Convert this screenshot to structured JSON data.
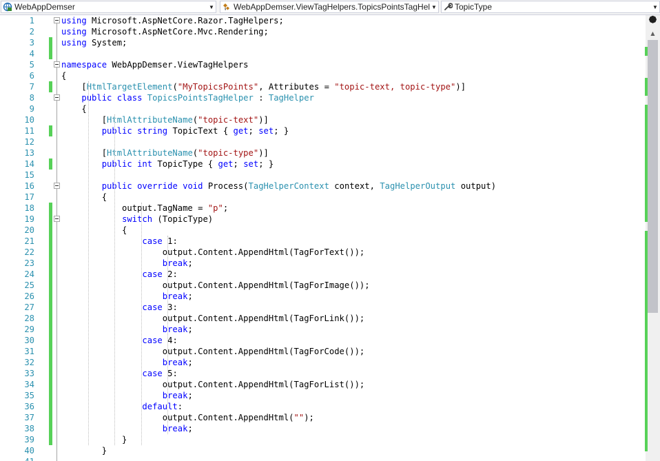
{
  "navbar": {
    "project": "WebAppDemser",
    "type": "WebAppDemser.ViewTagHelpers.TopicsPointsTagHelper",
    "member": "TopicType"
  },
  "colors": {
    "keyword": "#0000ff",
    "string": "#a31515",
    "type": "#2b91af",
    "line_number": "#2b91af",
    "change_saved": "#57d158"
  },
  "lines": [
    {
      "n": "1",
      "fold": true,
      "chg": false,
      "t": [
        [
          "using",
          "kw"
        ],
        [
          " Microsoft.AspNetCore.Razor.TagHelpers;",
          ""
        ]
      ]
    },
    {
      "n": "2",
      "fold": false,
      "chg": false,
      "t": [
        [
          "using",
          "kw"
        ],
        [
          " Microsoft.AspNetCore.Mvc.Rendering;",
          ""
        ]
      ]
    },
    {
      "n": "3",
      "fold": false,
      "chg": true,
      "t": [
        [
          "using",
          "kw"
        ],
        [
          " System;",
          ""
        ]
      ]
    },
    {
      "n": "4",
      "fold": false,
      "chg": true,
      "t": []
    },
    {
      "n": "5",
      "fold": true,
      "chg": false,
      "t": [
        [
          "namespace",
          "kw"
        ],
        [
          " WebAppDemser.ViewTagHelpers",
          ""
        ]
      ]
    },
    {
      "n": "6",
      "fold": false,
      "chg": false,
      "t": [
        [
          "{",
          ""
        ]
      ]
    },
    {
      "n": "7",
      "fold": false,
      "chg": true,
      "t": [
        [
          "    [",
          ""
        ],
        [
          "HtmlTargetElement",
          "ty"
        ],
        [
          "(",
          ""
        ],
        [
          "\"MyTopicsPoints\"",
          "st"
        ],
        [
          ", Attributes = ",
          ""
        ],
        [
          "\"topic-text, topic-type\"",
          "st"
        ],
        [
          ")]",
          ""
        ]
      ]
    },
    {
      "n": "8",
      "fold": true,
      "chg": false,
      "t": [
        [
          "    ",
          ""
        ],
        [
          "public",
          "kw"
        ],
        [
          " ",
          ""
        ],
        [
          "class",
          "kw"
        ],
        [
          " ",
          ""
        ],
        [
          "TopicsPointsTagHelper",
          "ty"
        ],
        [
          " : ",
          ""
        ],
        [
          "TagHelper",
          "ty"
        ]
      ]
    },
    {
      "n": "9",
      "fold": false,
      "chg": false,
      "t": [
        [
          "    {",
          ""
        ]
      ]
    },
    {
      "n": "10",
      "fold": false,
      "chg": false,
      "t": [
        [
          "        [",
          ""
        ],
        [
          "HtmlAttributeName",
          "ty"
        ],
        [
          "(",
          ""
        ],
        [
          "\"topic-text\"",
          "st"
        ],
        [
          ")]",
          ""
        ]
      ]
    },
    {
      "n": "11",
      "fold": false,
      "chg": true,
      "t": [
        [
          "        ",
          ""
        ],
        [
          "public",
          "kw"
        ],
        [
          " ",
          ""
        ],
        [
          "string",
          "kw"
        ],
        [
          " TopicText { ",
          ""
        ],
        [
          "get",
          "kw"
        ],
        [
          "; ",
          ""
        ],
        [
          "set",
          "kw"
        ],
        [
          "; }",
          ""
        ]
      ]
    },
    {
      "n": "12",
      "fold": false,
      "chg": false,
      "t": []
    },
    {
      "n": "13",
      "fold": false,
      "chg": false,
      "t": [
        [
          "        [",
          ""
        ],
        [
          "HtmlAttributeName",
          "ty"
        ],
        [
          "(",
          ""
        ],
        [
          "\"topic-type\"",
          "st"
        ],
        [
          ")]",
          ""
        ]
      ]
    },
    {
      "n": "14",
      "fold": false,
      "chg": true,
      "t": [
        [
          "        ",
          ""
        ],
        [
          "public",
          "kw"
        ],
        [
          " ",
          ""
        ],
        [
          "int",
          "kw"
        ],
        [
          " TopicType { ",
          ""
        ],
        [
          "get",
          "kw"
        ],
        [
          "; ",
          ""
        ],
        [
          "set",
          "kw"
        ],
        [
          "; }",
          ""
        ]
      ]
    },
    {
      "n": "15",
      "fold": false,
      "chg": false,
      "t": []
    },
    {
      "n": "16",
      "fold": true,
      "chg": false,
      "t": [
        [
          "        ",
          ""
        ],
        [
          "public",
          "kw"
        ],
        [
          " ",
          ""
        ],
        [
          "override",
          "kw"
        ],
        [
          " ",
          ""
        ],
        [
          "void",
          "kw"
        ],
        [
          " Process(",
          ""
        ],
        [
          "TagHelperContext",
          "ty"
        ],
        [
          " context, ",
          ""
        ],
        [
          "TagHelperOutput",
          "ty"
        ],
        [
          " output)",
          ""
        ]
      ]
    },
    {
      "n": "17",
      "fold": false,
      "chg": false,
      "t": [
        [
          "        {",
          ""
        ]
      ]
    },
    {
      "n": "18",
      "fold": false,
      "chg": true,
      "t": [
        [
          "            output.TagName = ",
          ""
        ],
        [
          "\"p\"",
          "st"
        ],
        [
          ";",
          ""
        ]
      ]
    },
    {
      "n": "19",
      "fold": true,
      "chg": true,
      "t": [
        [
          "            ",
          ""
        ],
        [
          "switch",
          "kw"
        ],
        [
          " (TopicType)",
          ""
        ]
      ]
    },
    {
      "n": "20",
      "fold": false,
      "chg": true,
      "t": [
        [
          "            {",
          ""
        ]
      ]
    },
    {
      "n": "21",
      "fold": false,
      "chg": true,
      "t": [
        [
          "                ",
          ""
        ],
        [
          "case",
          "kw"
        ],
        [
          " 1:",
          ""
        ]
      ]
    },
    {
      "n": "22",
      "fold": false,
      "chg": true,
      "t": [
        [
          "                    output.Content.AppendHtml(TagForText());",
          ""
        ]
      ]
    },
    {
      "n": "23",
      "fold": false,
      "chg": true,
      "t": [
        [
          "                    ",
          ""
        ],
        [
          "break",
          "kw"
        ],
        [
          ";",
          ""
        ]
      ]
    },
    {
      "n": "24",
      "fold": false,
      "chg": true,
      "t": [
        [
          "                ",
          ""
        ],
        [
          "case",
          "kw"
        ],
        [
          " 2:",
          ""
        ]
      ]
    },
    {
      "n": "25",
      "fold": false,
      "chg": true,
      "t": [
        [
          "                    output.Content.AppendHtml(TagForImage());",
          ""
        ]
      ]
    },
    {
      "n": "26",
      "fold": false,
      "chg": true,
      "t": [
        [
          "                    ",
          ""
        ],
        [
          "break",
          "kw"
        ],
        [
          ";",
          ""
        ]
      ]
    },
    {
      "n": "27",
      "fold": false,
      "chg": true,
      "t": [
        [
          "                ",
          ""
        ],
        [
          "case",
          "kw"
        ],
        [
          " 3:",
          ""
        ]
      ]
    },
    {
      "n": "28",
      "fold": false,
      "chg": true,
      "t": [
        [
          "                    output.Content.AppendHtml(TagForLink());",
          ""
        ]
      ]
    },
    {
      "n": "29",
      "fold": false,
      "chg": true,
      "t": [
        [
          "                    ",
          ""
        ],
        [
          "break",
          "kw"
        ],
        [
          ";",
          ""
        ]
      ]
    },
    {
      "n": "30",
      "fold": false,
      "chg": true,
      "t": [
        [
          "                ",
          ""
        ],
        [
          "case",
          "kw"
        ],
        [
          " 4:",
          ""
        ]
      ]
    },
    {
      "n": "31",
      "fold": false,
      "chg": true,
      "t": [
        [
          "                    output.Content.AppendHtml(TagForCode());",
          ""
        ]
      ]
    },
    {
      "n": "32",
      "fold": false,
      "chg": true,
      "t": [
        [
          "                    ",
          ""
        ],
        [
          "break",
          "kw"
        ],
        [
          ";",
          ""
        ]
      ]
    },
    {
      "n": "33",
      "fold": false,
      "chg": true,
      "t": [
        [
          "                ",
          ""
        ],
        [
          "case",
          "kw"
        ],
        [
          " 5:",
          ""
        ]
      ]
    },
    {
      "n": "34",
      "fold": false,
      "chg": true,
      "t": [
        [
          "                    output.Content.AppendHtml(TagForList());",
          ""
        ]
      ]
    },
    {
      "n": "35",
      "fold": false,
      "chg": true,
      "t": [
        [
          "                    ",
          ""
        ],
        [
          "break",
          "kw"
        ],
        [
          ";",
          ""
        ]
      ]
    },
    {
      "n": "36",
      "fold": false,
      "chg": true,
      "t": [
        [
          "                ",
          ""
        ],
        [
          "default",
          "kw"
        ],
        [
          ":",
          ""
        ]
      ]
    },
    {
      "n": "37",
      "fold": false,
      "chg": true,
      "t": [
        [
          "                    output.Content.AppendHtml(",
          ""
        ],
        [
          "\"\"",
          "st"
        ],
        [
          ");",
          ""
        ]
      ]
    },
    {
      "n": "38",
      "fold": false,
      "chg": true,
      "t": [
        [
          "                    ",
          ""
        ],
        [
          "break",
          "kw"
        ],
        [
          ";",
          ""
        ]
      ]
    },
    {
      "n": "39",
      "fold": false,
      "chg": true,
      "t": [
        [
          "            }",
          ""
        ]
      ]
    },
    {
      "n": "40",
      "fold": false,
      "chg": false,
      "t": [
        [
          "        }",
          ""
        ]
      ]
    },
    {
      "n": "41",
      "fold": false,
      "chg": false,
      "t": []
    }
  ]
}
